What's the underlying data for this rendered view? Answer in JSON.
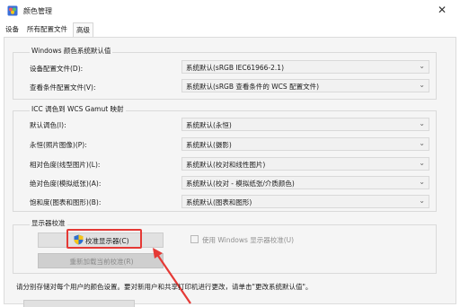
{
  "window": {
    "title": "颜色管理",
    "close_glyph": "✕",
    "icon": "color-management-icon"
  },
  "tabs": [
    {
      "label": "设备"
    },
    {
      "label": "所有配置文件"
    },
    {
      "label": "高级"
    }
  ],
  "windows_defaults": {
    "title": "Windows 颜色系统默认值",
    "rows": [
      {
        "label": "设备配置文件(D):",
        "value": "系统默认(sRGB IEC61966-2.1)"
      },
      {
        "label": "查看条件配置文件(V):",
        "value": "系统默认(sRGB 查看条件的 WCS 配置文件)"
      }
    ]
  },
  "icc_mapping": {
    "title": "ICC 调色到 WCS Gamut 映射",
    "rows": [
      {
        "label": "默认调色(I):",
        "value": "系统默认(永恒)"
      },
      {
        "label": "永恒(照片图像)(P):",
        "value": "系统默认(摄影)"
      },
      {
        "label": "相对色度(线型图片)(L):",
        "value": "系统默认(校对和线性图片)"
      },
      {
        "label": "绝对色度(模拟纸张)(A):",
        "value": "系统默认(校对 - 模拟纸张/介质颜色)"
      },
      {
        "label": "饱和度(图表和图形)(B):",
        "value": "系统默认(图表和图形)"
      }
    ]
  },
  "calibration": {
    "title": "显示器校准",
    "calibrate_button": "校准显示器(C)",
    "reload_button": "重新加载当前校准(R)",
    "checkbox_label": "使用 Windows 显示器校准(U)"
  },
  "footer": {
    "note": "请分别存储对每个用户的颜色设置。要对新用户和共享打印机进行更改，请单击\"更改系统默认值\"。"
  },
  "colors": {
    "highlight": "#e53935",
    "accent_shield_blue": "#2f6fd0",
    "accent_shield_yellow": "#f5c518"
  }
}
